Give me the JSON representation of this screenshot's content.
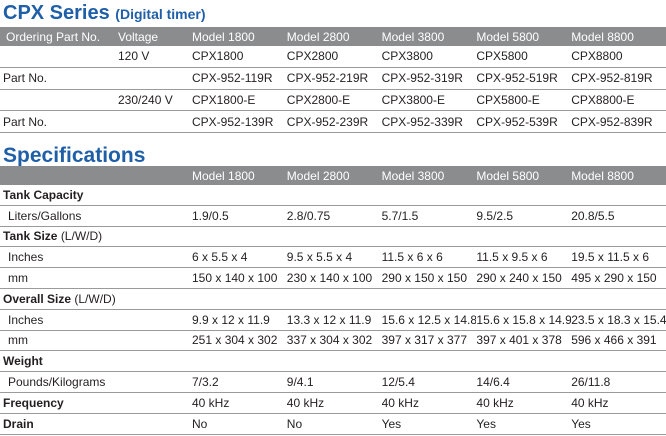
{
  "series_title": "CPX Series",
  "series_subtitle": "(Digital timer)",
  "ordering": {
    "header": [
      "Ordering Part No.",
      "Voltage",
      "Model 1800",
      "Model 2800",
      "Model 3800",
      "Model 5800",
      "Model 8800"
    ],
    "rows": [
      {
        "label": "",
        "voltage": "120 V",
        "cells": [
          "CPX1800",
          "CPX2800",
          "CPX3800",
          "CPX5800",
          "CPX8800"
        ]
      },
      {
        "label": "Part No.",
        "voltage": "",
        "cells": [
          "CPX-952-119R",
          "CPX-952-219R",
          "CPX-952-319R",
          "CPX-952-519R",
          "CPX-952-819R"
        ]
      },
      {
        "label": "",
        "voltage": "230/240 V",
        "cells": [
          "CPX1800-E",
          "CPX2800-E",
          "CPX3800-E",
          "CPX5800-E",
          "CPX8800-E"
        ]
      },
      {
        "label": "Part No.",
        "voltage": "",
        "cells": [
          "CPX-952-139R",
          "CPX-952-239R",
          "CPX-952-339R",
          "CPX-952-539R",
          "CPX-952-839R"
        ]
      }
    ]
  },
  "specs_title": "Specifications",
  "specs": {
    "header": [
      "Model 1800",
      "Model 2800",
      "Model 3800",
      "Model 5800",
      "Model 8800"
    ],
    "tank_capacity": {
      "label": "Tank Capacity"
    },
    "liters_gallons": {
      "label": "Liters/Gallons",
      "cells": [
        "1.9/0.5",
        "2.8/0.75",
        "5.7/1.5",
        "9.5/2.5",
        "20.8/5.5"
      ]
    },
    "tank_size": {
      "label": "Tank Size",
      "note": "(L/W/D)"
    },
    "tank_inches": {
      "label": "Inches",
      "cells": [
        "6 x 5.5 x 4",
        "9.5 x 5.5 x 4",
        "11.5 x 6 x 6",
        "11.5 x 9.5 x 6",
        "19.5 x 11.5 x 6"
      ]
    },
    "tank_mm": {
      "label": "mm",
      "cells": [
        "150 x 140 x 100",
        "230 x 140 x 100",
        "290 x 150 x 150",
        "290 x 240 x 150",
        "495 x 290 x 150"
      ]
    },
    "overall_size": {
      "label": "Overall Size",
      "note": "(L/W/D)"
    },
    "overall_inches": {
      "label": "Inches",
      "cells": [
        "9.9 x 12 x 11.9",
        "13.3 x 12 x 11.9",
        "15.6 x 12.5 x 14.8",
        "15.6 x 15.8 x 14.9",
        "23.5 x 18.3 x 15.4"
      ]
    },
    "overall_mm": {
      "label": "mm",
      "cells": [
        "251 x 304 x 302",
        "337 x 304 x 302",
        "397 x 317 x 377",
        "397 x 401 x 378",
        "596 x 466 x 391"
      ]
    },
    "weight": {
      "label": "Weight"
    },
    "pounds_kg": {
      "label": "Pounds/Kilograms",
      "cells": [
        "7/3.2",
        "9/4.1",
        "12/5.4",
        "14/6.4",
        "26/11.8"
      ]
    },
    "frequency": {
      "label": "Frequency",
      "cells": [
        "40 kHz",
        "40 kHz",
        "40 kHz",
        "40 kHz",
        "40 kHz"
      ]
    },
    "drain": {
      "label": "Drain",
      "cells": [
        "No",
        "No",
        "Yes",
        "Yes",
        "Yes"
      ]
    }
  }
}
